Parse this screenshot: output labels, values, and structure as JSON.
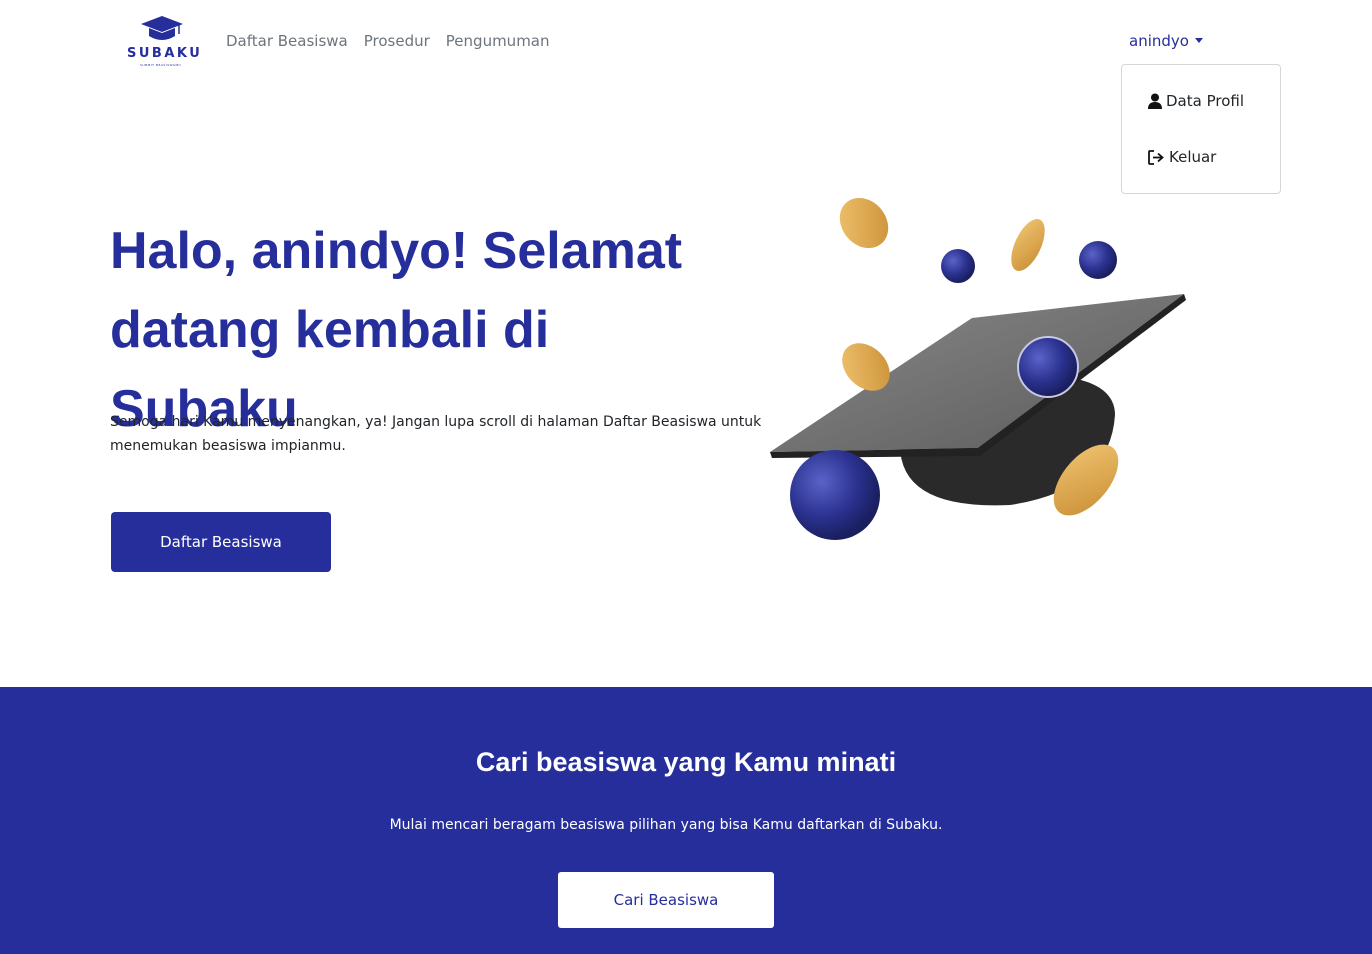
{
  "brand": {
    "name": "SUBAKU",
    "tagline": "SUBMIT BEASISWAMU",
    "color": "#252e9b"
  },
  "nav": {
    "links": [
      "Daftar Beasiswa",
      "Prosedur",
      "Pengumuman"
    ],
    "user": "anindyo",
    "dropdown": [
      "Data Profil",
      "Keluar"
    ]
  },
  "hero": {
    "title": "Halo, anindyo! Selamat datang kembali di Subaku",
    "description": "Semoga hari Kamu menyenangkan, ya! Jangan lupa scroll di halaman Daftar Beasiswa untuk menemukan beasiswa impianmu.",
    "button": "Daftar Beasiswa"
  },
  "cta": {
    "title": "Cari beasiswa yang Kamu minati",
    "subtitle": "Mulai mencari beragam beasiswa pilihan yang bisa Kamu daftarkan di Subaku.",
    "button": "Cari Beasiswa"
  },
  "icons": [
    "graduation-cap-logo-icon",
    "user-icon",
    "logout-icon",
    "caret-down-icon"
  ]
}
